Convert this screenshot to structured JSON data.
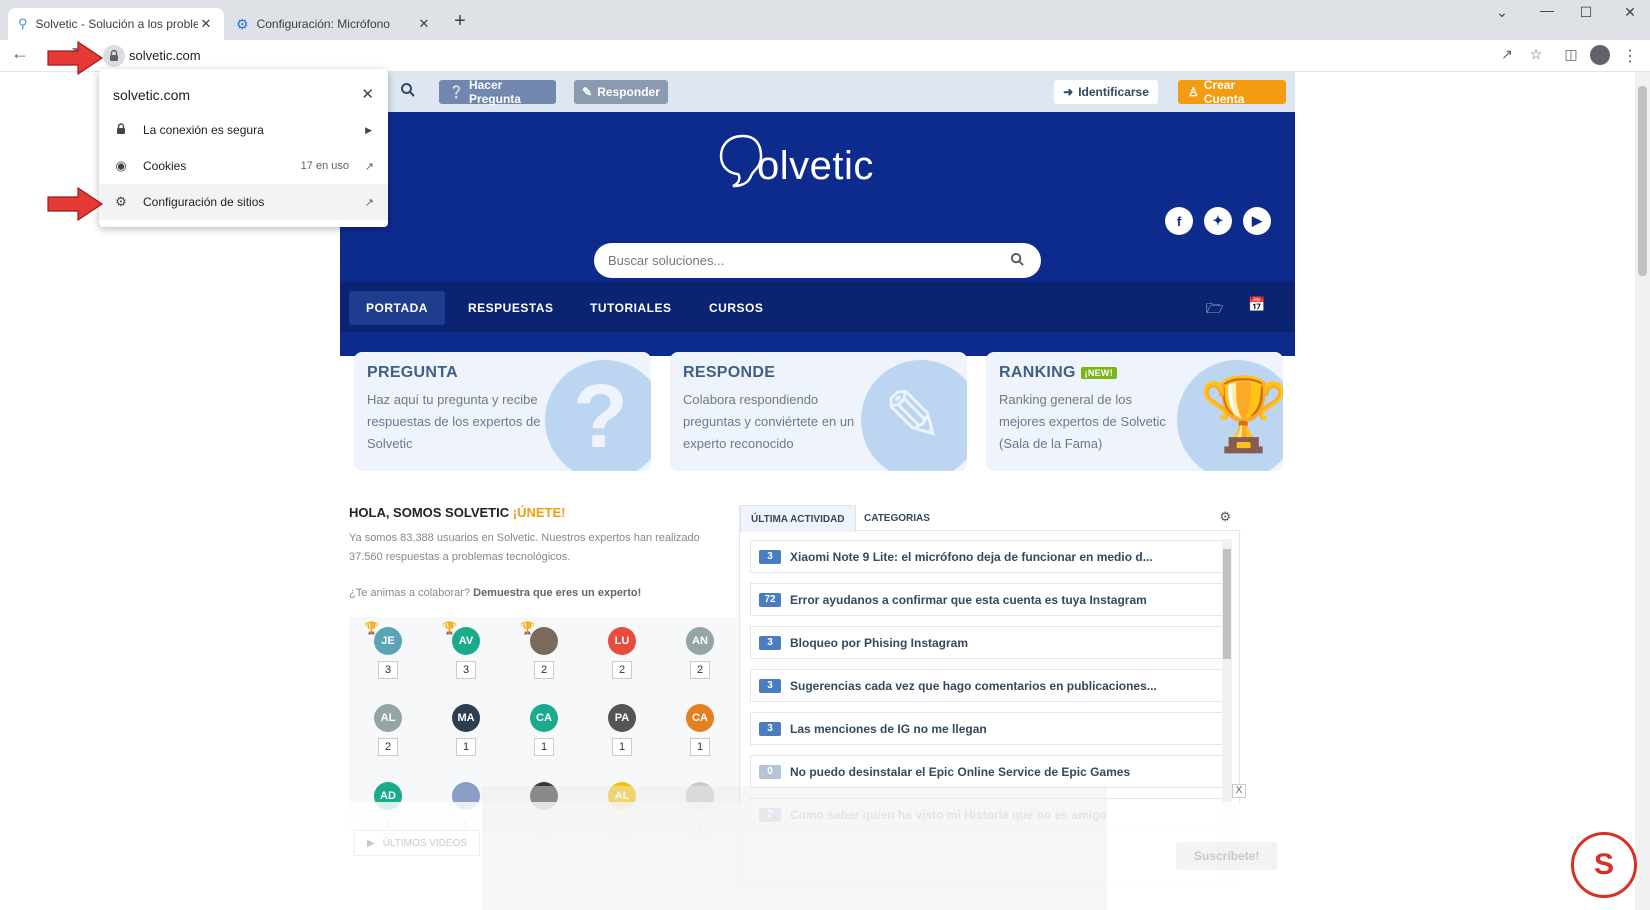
{
  "browser": {
    "tabs": [
      {
        "title": "Solvetic - Solución a los problem",
        "icon": "solvetic-favicon",
        "active": true
      },
      {
        "title": "Configuración: Micrófono",
        "icon": "gear-icon",
        "active": false
      }
    ],
    "url": "solvetic.com"
  },
  "site_popup": {
    "host": "solvetic.com",
    "rows": [
      {
        "label": "La conexión es segura",
        "icon": "lock-icon"
      },
      {
        "label": "Cookies",
        "meta": "17 en uso",
        "icon": "cookie-icon"
      },
      {
        "label": "Configuración de sitios",
        "icon": "gear-icon"
      }
    ]
  },
  "site": {
    "topbar": {
      "ask": "Hacer Pregunta",
      "answer": "Responder",
      "login": "Identificarse",
      "register": "Crear Cuenta"
    },
    "logo_text": "Solvetic",
    "search_placeholder": "Buscar soluciones...",
    "nav": [
      "PORTADA",
      "RESPUESTAS",
      "TUTORIALES",
      "CURSOS"
    ],
    "cards": [
      {
        "title": "PREGUNTA",
        "text": "Haz aquí tu pregunta y recibe respuestas de los expertos de Solvetic"
      },
      {
        "title": "RESPONDE",
        "text": "Colabora respondiendo preguntas y conviértete en un experto reconocido"
      },
      {
        "title": "RANKING",
        "badge": "¡NEW!",
        "text": "Ranking general de los mejores expertos de Solvetic (Sala de la Fama)"
      }
    ],
    "welcome": {
      "title": "HOLA, SOMOS SOLVETIC",
      "join": "¡ÚNETE!",
      "text": "Ya somos 83.388 usuarios en Solvetic. Nuestros expertos han realizado 37.560 respuestas a problemas tecnológicos.",
      "cta_question": "¿Te animas a colaborar?",
      "cta_bold": "Demuestra que eres un experto!"
    },
    "experts": [
      {
        "initials": "JE",
        "count": "3",
        "color": "#5ba3b5",
        "trophy": "gold"
      },
      {
        "initials": "AV",
        "count": "3",
        "color": "#1aaa8c",
        "trophy": "silver"
      },
      {
        "initials": "",
        "count": "2",
        "color": "#7a6a5a",
        "trophy": "bronze"
      },
      {
        "initials": "LU",
        "count": "2",
        "color": "#e74c3c"
      },
      {
        "initials": "AN",
        "count": "2",
        "color": "#95a5a6"
      },
      {
        "initials": "AL",
        "count": "2",
        "color": "#95a5a6"
      },
      {
        "initials": "MA",
        "count": "1",
        "color": "#2c3e50"
      },
      {
        "initials": "CA",
        "count": "1",
        "color": "#1aaa8c"
      },
      {
        "initials": "PA",
        "count": "1",
        "color": "#555"
      },
      {
        "initials": "CA",
        "count": "1",
        "color": "#e67e22"
      },
      {
        "initials": "AD",
        "count": "1",
        "color": "#1aaa8c"
      },
      {
        "initials": "",
        "count": "1",
        "color": "#8b9ec7"
      },
      {
        "initials": "",
        "count": "1",
        "color": "#3b3b3b"
      },
      {
        "initials": "AL",
        "count": "1",
        "color": "#f1c40f"
      },
      {
        "initials": "",
        "count": "1",
        "color": "#ccc"
      }
    ],
    "activity_tabs": [
      "ÚLTIMA ACTIVIDAD",
      "CATEGORIAS"
    ],
    "activity": [
      {
        "count": "3",
        "title": "Xiaomi Note 9 Lite: el micrófono deja de funcionar en medio d..."
      },
      {
        "count": "72",
        "title": "Error ayudanos a confirmar que esta cuenta es tuya Instagram"
      },
      {
        "count": "3",
        "title": "Bloqueo por Phising Instagram"
      },
      {
        "count": "3",
        "title": "Sugerencias cada vez que hago comentarios en publicaciones..."
      },
      {
        "count": "3",
        "title": "Las menciones de IG no me llegan"
      },
      {
        "count": "0",
        "title": "No puedo desinstalar el Epic Online Service de Epic Games"
      },
      {
        "count": "2",
        "title": "Como saber quien ha visto mi Historia que no es amigo"
      }
    ],
    "videos_label": "ÚLTIMOS VIDEOS",
    "subscribe": "Suscríbete!",
    "ad_close": "X"
  },
  "colors": {
    "hero": "#0d2b8d",
    "nav": "#0a2472",
    "accent_orange": "#f39c12",
    "badge_blue": "#4a7cc0",
    "arrow_red": "#e53935"
  }
}
